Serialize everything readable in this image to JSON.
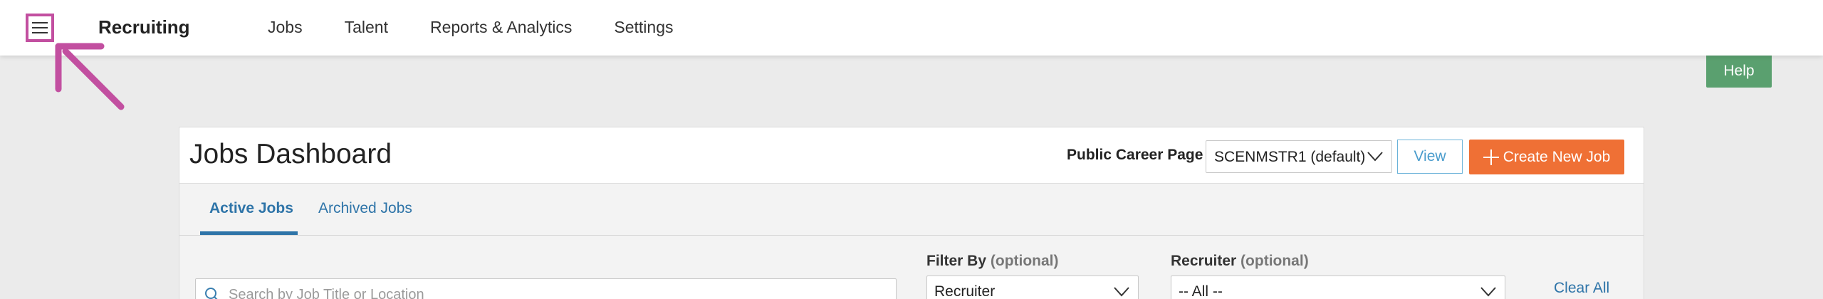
{
  "header": {
    "brand": "Recruiting",
    "nav": [
      {
        "label": "Jobs"
      },
      {
        "label": "Talent"
      },
      {
        "label": "Reports & Analytics"
      },
      {
        "label": "Settings"
      }
    ],
    "menu_icon": "hamburger-menu-icon"
  },
  "help": {
    "label": "Help"
  },
  "dashboard": {
    "title": "Jobs Dashboard",
    "career_page_label": "Public Career Page",
    "career_page_value": "SCENMSTR1 (default)",
    "view_label": "View",
    "create_label": "Create New Job",
    "tabs": [
      {
        "label": "Active Jobs",
        "active": true
      },
      {
        "label": "Archived Jobs",
        "active": false
      }
    ],
    "search": {
      "placeholder": "Search by Job Title or Location"
    },
    "filter_by": {
      "label": "Filter By",
      "optional": "(optional)",
      "value": "Recruiter"
    },
    "recruiter": {
      "label": "Recruiter",
      "optional": "(optional)",
      "value": "-- All --"
    },
    "clear_all": "Clear All"
  },
  "colors": {
    "annotation": "#c24fa0",
    "help": "#5aa06f",
    "create": "#ef7035",
    "link": "#2e74a8",
    "view_border": "#6bb3d9"
  }
}
